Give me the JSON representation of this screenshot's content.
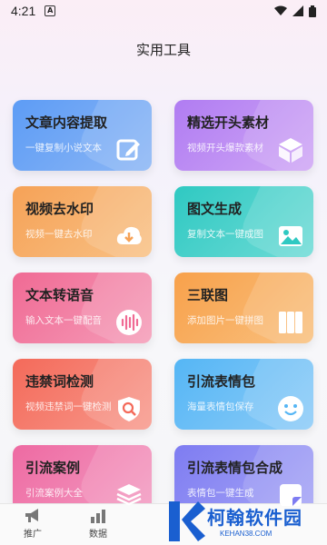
{
  "status_bar": {
    "time": "4:21",
    "notification_icon_letter": "A"
  },
  "page_title": "实用工具",
  "cards": [
    {
      "title": "文章内容提取",
      "subtitle": "一键复制小说文本",
      "icon": "edit-icon",
      "gradient": [
        "#5d9cf5",
        "#8bb6f5"
      ]
    },
    {
      "title": "精选开头素材",
      "subtitle": "视频开头爆款素材",
      "icon": "cube-icon",
      "gradient": [
        "#b07cf2",
        "#cfa6f5"
      ]
    },
    {
      "title": "视频去水印",
      "subtitle": "视频一键去水印",
      "icon": "cloud-download-icon",
      "gradient": [
        "#f6a257",
        "#f8c185"
      ]
    },
    {
      "title": "图文生成",
      "subtitle": "复制文本一键成图",
      "icon": "image-icon",
      "gradient": [
        "#2fc9c2",
        "#6edbd6"
      ]
    },
    {
      "title": "文本转语音",
      "subtitle": "输入文本一键配音",
      "icon": "voice-wave-icon",
      "gradient": [
        "#f06a94",
        "#f59cb8"
      ]
    },
    {
      "title": "三联图",
      "subtitle": "添加图片一键拼图",
      "icon": "triptych-icon",
      "gradient": [
        "#f8a14b",
        "#f9c07e"
      ]
    },
    {
      "title": "违禁词检测",
      "subtitle": "视频违禁词一键检测",
      "icon": "shield-search-icon",
      "gradient": [
        "#f46a5a",
        "#f7998c"
      ]
    },
    {
      "title": "引流表情包",
      "subtitle": "海量表情包保存",
      "icon": "smile-icon",
      "gradient": [
        "#55b6f5",
        "#8ccbf7"
      ]
    },
    {
      "title": "引流案例",
      "subtitle": "引流案例大全",
      "icon": "layers-icon",
      "gradient": [
        "#ee6aa2",
        "#f39cc2"
      ]
    },
    {
      "title": "引流表情包合成",
      "subtitle": "表情包一键生成",
      "icon": "sticker-icon",
      "gradient": [
        "#7e7cf2",
        "#a6a5f5"
      ]
    }
  ],
  "bottom_nav": [
    {
      "label": "推广",
      "icon": "megaphone-icon"
    },
    {
      "label": "数据",
      "icon": "chart-icon"
    }
  ],
  "watermark": {
    "brand": "柯翰软件园",
    "url": "KEHAN38.COM"
  }
}
